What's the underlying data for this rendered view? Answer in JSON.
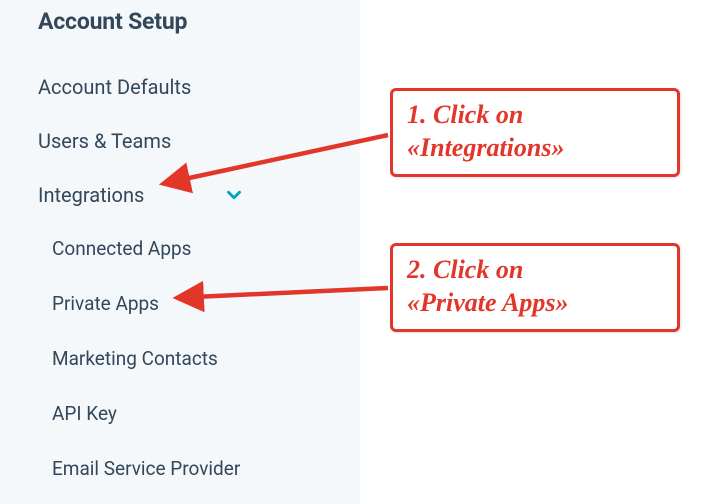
{
  "sidebar": {
    "section_title": "Account Setup",
    "items": {
      "account_defaults": "Account Defaults",
      "users_teams": "Users & Teams",
      "integrations": {
        "label": "Integrations",
        "expanded": true,
        "children": {
          "connected_apps": "Connected Apps",
          "private_apps": "Private Apps",
          "marketing_contacts": "Marketing Contacts",
          "api_key": "API Key",
          "email_service_provider": "Email Service Provider"
        }
      }
    }
  },
  "annotations": {
    "step1": {
      "line1": "1. Click on",
      "line2": "«Integrations»"
    },
    "step2": {
      "line1": "2. Click on",
      "line2": "«Private Apps»"
    }
  },
  "colors": {
    "annotation_red": "#e3362b",
    "accent": "#00a4bd",
    "text": "#33475b",
    "sidebar_bg": "#f5f8fa"
  }
}
